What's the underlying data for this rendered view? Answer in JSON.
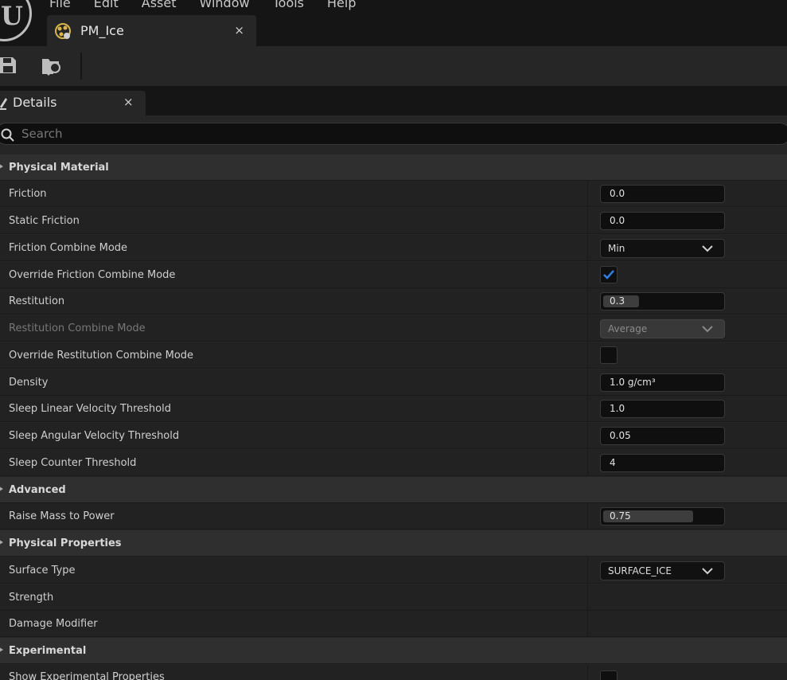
{
  "menu": [
    "File",
    "Edit",
    "Asset",
    "Window",
    "Tools",
    "Help"
  ],
  "tab": {
    "title": "PM_Ice",
    "close": "×"
  },
  "toolbar": {
    "save_icon": "save-icon",
    "browse_icon": "browse-asset-icon"
  },
  "details_tab": {
    "label": "Details",
    "close": "×"
  },
  "search": {
    "placeholder": "Search"
  },
  "colors": {
    "checkbox_accent": "#2f7ee8",
    "panel_bg": "#262626",
    "row_bg": "#222222",
    "category_bg": "#2f2f2f"
  },
  "sections": {
    "physical_material": {
      "title": "Physical Material",
      "friction": {
        "label": "Friction",
        "value": "0.0"
      },
      "static_friction": {
        "label": "Static Friction",
        "value": "0.0"
      },
      "friction_combine_mode": {
        "label": "Friction Combine Mode",
        "value": "Min"
      },
      "override_friction_combine_mode": {
        "label": "Override Friction Combine Mode",
        "checked": true
      },
      "restitution": {
        "label": "Restitution",
        "value": "0.3",
        "fraction": 0.3
      },
      "restitution_combine_mode": {
        "label": "Restitution Combine Mode",
        "value": "Average",
        "enabled": false
      },
      "override_restitution_combine_mode": {
        "label": "Override Restitution Combine Mode",
        "checked": false
      },
      "density": {
        "label": "Density",
        "value": "1.0 g/cm³"
      },
      "sleep_linear_velocity_threshold": {
        "label": "Sleep Linear Velocity Threshold",
        "value": "1.0"
      },
      "sleep_angular_velocity_threshold": {
        "label": "Sleep Angular Velocity Threshold",
        "value": "0.05"
      },
      "sleep_counter_threshold": {
        "label": "Sleep Counter Threshold",
        "value": "4"
      }
    },
    "advanced": {
      "title": "Advanced",
      "raise_mass_to_power": {
        "label": "Raise Mass to Power",
        "value": "0.75",
        "fraction": 0.75
      }
    },
    "physical_properties": {
      "title": "Physical Properties",
      "surface_type": {
        "label": "Surface Type",
        "value": "SURFACE_ICE"
      },
      "strength": {
        "label": "Strength"
      },
      "damage_modifier": {
        "label": "Damage Modifier"
      }
    },
    "experimental": {
      "title": "Experimental",
      "show_experimental_properties": {
        "label": "Show Experimental Properties"
      }
    }
  }
}
